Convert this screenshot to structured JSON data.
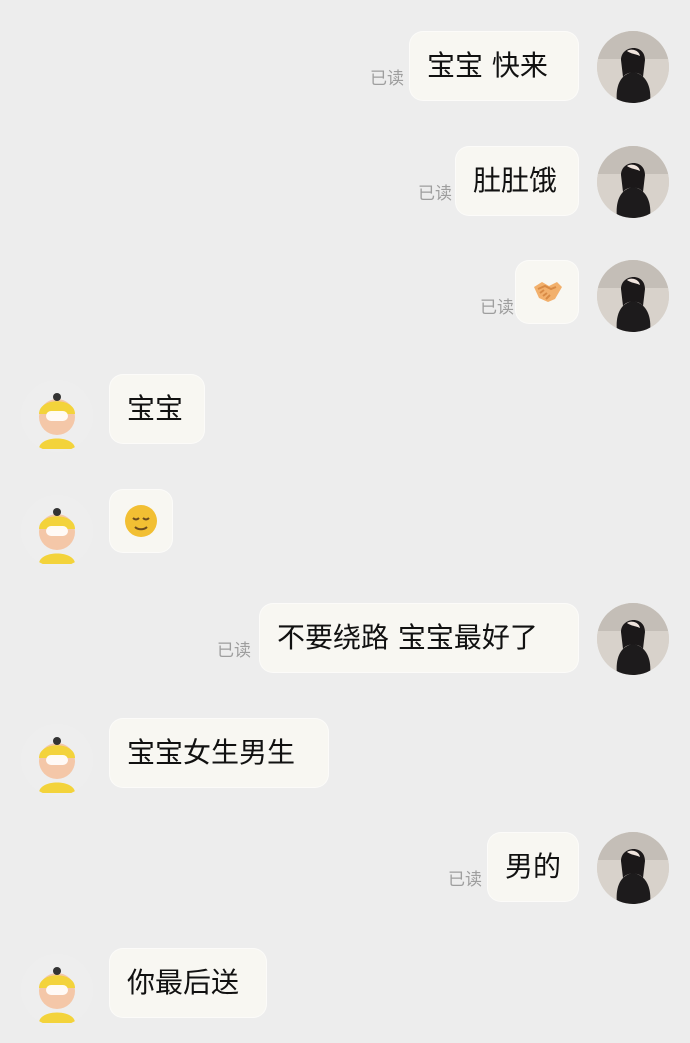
{
  "chat": {
    "read_label": "已读",
    "messages": [
      {
        "side": "right",
        "text": "宝宝  快来",
        "read": true
      },
      {
        "side": "right",
        "text": "肚肚饿",
        "read": true
      },
      {
        "side": "right",
        "emoji": "handshake-emoji",
        "read": true
      },
      {
        "side": "left",
        "text": "宝宝"
      },
      {
        "side": "left",
        "emoji": "content-face-emoji"
      },
      {
        "side": "right",
        "text": "不要绕路  宝宝最好了",
        "read": true
      },
      {
        "side": "left",
        "text": "宝宝女生男生"
      },
      {
        "side": "right",
        "text": "男的",
        "read": true
      },
      {
        "side": "left",
        "text": "你最后送"
      }
    ]
  },
  "colors": {
    "background": "#ededed",
    "bubble": "#f8f7f2",
    "read_text": "#9e9e9e",
    "left_avatar_accent": "#f3d33b",
    "right_avatar_bg": "#d8d2cb"
  }
}
